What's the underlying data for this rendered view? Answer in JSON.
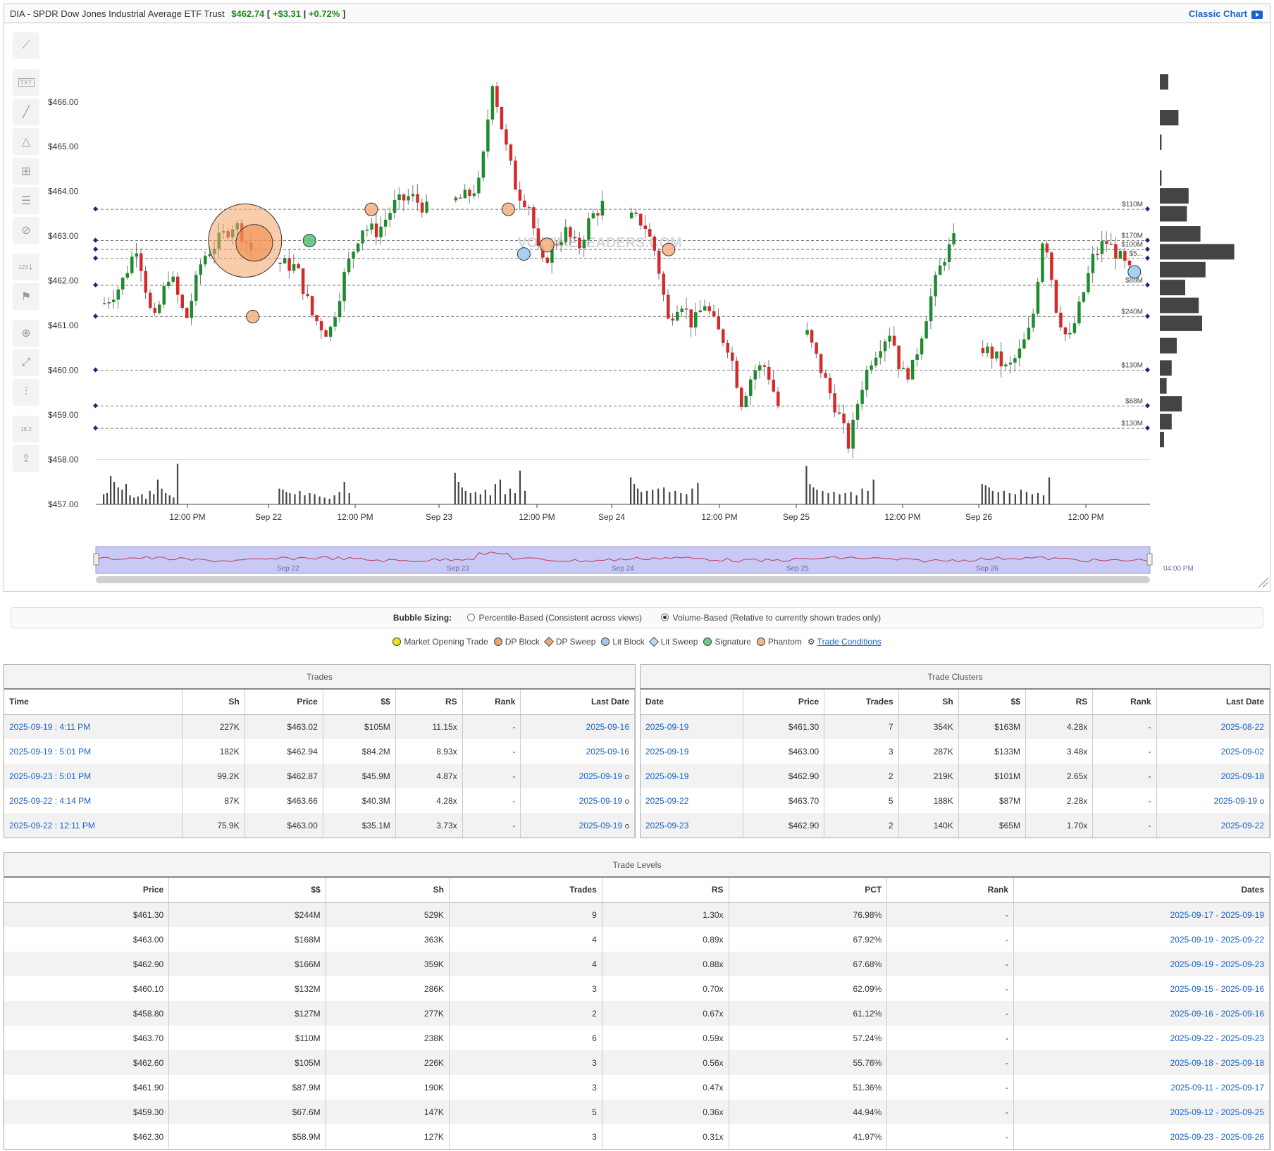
{
  "header": {
    "symbol": "DIA - SPDR Dow Jones Industrial Average ETF Trust",
    "price": "$462.74",
    "change": "+$3.31",
    "pct": "+0.72%",
    "open_bracket": "[",
    "sep": "|",
    "close_bracket": "]",
    "classic_chart": "Classic Chart"
  },
  "watermark": "VOLUMELEADERS.COM",
  "toolbar": {
    "txt": "TXT",
    "num": "123",
    "eye_label": "16.2"
  },
  "bubble_sizing": {
    "label": "Bubble Sizing:",
    "opt1": "Percentile-Based (Consistent across views)",
    "opt2": "Volume-Based (Relative to currently shown trades only)"
  },
  "legend": {
    "items": [
      {
        "label": "Market Opening Trade",
        "color": "#f4e417",
        "shape": "circle"
      },
      {
        "label": "DP Block",
        "color": "#f0a569",
        "shape": "circle"
      },
      {
        "label": "DP Sweep",
        "color": "#e8a878",
        "shape": "diamond"
      },
      {
        "label": "Lit Block",
        "color": "#9dcbf0",
        "shape": "circle"
      },
      {
        "label": "Lit Sweep",
        "color": "#b8d8f4",
        "shape": "diamond"
      },
      {
        "label": "Signature",
        "color": "#6cc98a",
        "shape": "circle"
      },
      {
        "label": "Phantom",
        "color": "#f3b68c",
        "shape": "circle"
      }
    ],
    "trade_conditions": "Trade Conditions"
  },
  "chart_data": {
    "type": "candlestick",
    "y_ticks": [
      "$466.00",
      "$465.00",
      "$464.00",
      "$463.00",
      "$462.00",
      "$461.00",
      "$460.00",
      "$459.00",
      "$458.00",
      "$457.00"
    ],
    "ylim": [
      457,
      466.8
    ],
    "x_labels": [
      "12:00 PM",
      "Sep 22",
      "12:00 PM",
      "Sep 23",
      "12:00 PM",
      "Sep 24",
      "12:00 PM",
      "Sep 25",
      "12:00 PM",
      "Sep 26",
      "12:00 PM"
    ],
    "nav_labels": [
      "Sep 22",
      "Sep 23",
      "Sep 24",
      "Sep 25",
      "Sep 26",
      "04:00 PM"
    ],
    "levels": [
      {
        "price": 463.6,
        "label": "$110M"
      },
      {
        "price": 462.9,
        "label": "$170M"
      },
      {
        "price": 462.7,
        "label": "$100M"
      },
      {
        "price": 462.5,
        "label": "$5..."
      },
      {
        "price": 461.9,
        "label": "$88M"
      },
      {
        "price": 461.2,
        "label": "$240M"
      },
      {
        "price": 460.0,
        "label": "$130M"
      },
      {
        "price": 459.2,
        "label": "$68M"
      },
      {
        "price": 458.7,
        "label": "$130M"
      }
    ],
    "days": [
      {
        "start": 461.5,
        "path": [
          461.9,
          462.8,
          461.0,
          462.2,
          461.1,
          462.5,
          462.9,
          463.3,
          462.7
        ],
        "vol": [
          9,
          10,
          25,
          20,
          15,
          13,
          18,
          8,
          6,
          7,
          9,
          5,
          12,
          9,
          22,
          14,
          10,
          8,
          6,
          36
        ]
      },
      {
        "start": 462.4,
        "path": [
          462.3,
          461.2,
          460.8,
          462.2,
          463.2,
          463.1,
          463.7,
          463.9,
          463.6
        ],
        "vol": [
          14,
          13,
          11,
          10,
          9,
          12,
          8,
          10,
          9,
          7,
          6,
          5,
          8,
          11,
          20,
          10
        ]
      },
      {
        "start": 463.8,
        "path": [
          463.9,
          464.2,
          466.5,
          465.1,
          464.0,
          463.7,
          462.3,
          462.8,
          463.1,
          462.7,
          463.4,
          463.7
        ],
        "vol": [
          28,
          20,
          15,
          12,
          10,
          11,
          9,
          13,
          8,
          18,
          22,
          9,
          14,
          10,
          30,
          12
        ]
      },
      {
        "start": 463.4,
        "path": [
          463.3,
          462.6,
          461.1,
          461.6,
          461.0,
          461.5,
          460.9,
          460.5,
          459.3,
          460.0,
          460.1,
          459.2
        ],
        "vol": [
          24,
          18,
          14,
          11,
          12,
          13,
          14,
          15,
          11,
          12,
          10,
          9,
          14,
          19
        ]
      },
      {
        "start": 460.8,
        "path": [
          460.2,
          459.6,
          459.0,
          458.3,
          459.5,
          460.2,
          460.6,
          460.9,
          459.9,
          460.0,
          460.9,
          461.8,
          462.5,
          462.9
        ],
        "vol": [
          34,
          18,
          15,
          13,
          12,
          10,
          11,
          9,
          10,
          11,
          8,
          14,
          12,
          22
        ]
      },
      {
        "start": 460.5,
        "path": [
          460.3,
          460.0,
          460.4,
          461.0,
          463.2,
          461.4,
          460.6,
          461.5,
          462.5,
          462.9,
          462.6,
          462.2
        ],
        "vol": [
          18,
          17,
          15,
          12,
          11,
          12,
          10,
          9,
          13,
          11,
          9,
          10,
          8,
          24
        ]
      }
    ],
    "bubbles": [
      {
        "day": 0,
        "f": 0.92,
        "price": 462.9,
        "r": 52,
        "color": "#f4a468",
        "alpha": 0.55
      },
      {
        "day": 0,
        "f": 0.98,
        "price": 462.85,
        "r": 26,
        "color": "#f08a4a",
        "alpha": 0.6
      },
      {
        "day": 0,
        "f": 0.97,
        "price": 461.2,
        "r": 9,
        "color": "#f4b486",
        "alpha": 0.9
      },
      {
        "day": 1,
        "f": 0.2,
        "price": 462.9,
        "r": 9,
        "color": "#5cc47e",
        "alpha": 0.9
      },
      {
        "day": 1,
        "f": 0.6,
        "price": 463.6,
        "r": 9,
        "color": "#f4b486",
        "alpha": 0.9
      },
      {
        "day": 2,
        "f": 0.35,
        "price": 463.6,
        "r": 9,
        "color": "#f4b486",
        "alpha": 0.9
      },
      {
        "day": 2,
        "f": 0.45,
        "price": 462.6,
        "r": 9,
        "color": "#9dcbf0",
        "alpha": 0.9
      },
      {
        "day": 2,
        "f": 0.6,
        "price": 462.8,
        "r": 10,
        "color": "#f4b486",
        "alpha": 0.9
      },
      {
        "day": 3,
        "f": 0.25,
        "price": 462.7,
        "r": 9,
        "color": "#f4b486",
        "alpha": 0.9
      },
      {
        "day": 5,
        "f": 0.99,
        "price": 462.2,
        "r": 9,
        "color": "#9dcbf0",
        "alpha": 0.9
      }
    ],
    "profile": [
      {
        "price": 466.45,
        "w": 10
      },
      {
        "price": 465.65,
        "w": 22
      },
      {
        "price": 465.1,
        "w": 2
      },
      {
        "price": 464.3,
        "w": 2
      },
      {
        "price": 463.9,
        "w": 34
      },
      {
        "price": 463.5,
        "w": 32
      },
      {
        "price": 463.05,
        "w": 48
      },
      {
        "price": 462.65,
        "w": 88
      },
      {
        "price": 462.25,
        "w": 54
      },
      {
        "price": 461.85,
        "w": 30
      },
      {
        "price": 461.45,
        "w": 46
      },
      {
        "price": 461.05,
        "w": 50
      },
      {
        "price": 460.55,
        "w": 20
      },
      {
        "price": 460.05,
        "w": 14
      },
      {
        "price": 459.65,
        "w": 8
      },
      {
        "price": 459.25,
        "w": 26
      },
      {
        "price": 458.85,
        "w": 14
      },
      {
        "price": 458.45,
        "w": 5
      }
    ]
  },
  "trades": {
    "title": "Trades",
    "columns": [
      "Time",
      "Sh",
      "Price",
      "$$",
      "RS",
      "Rank",
      "Last Date"
    ],
    "rows": [
      [
        "2025-09-19 : 4:11 PM",
        "227K",
        "$463.02",
        "$105M",
        "11.15x",
        "-",
        "2025-09-16",
        ""
      ],
      [
        "2025-09-19 : 5:01 PM",
        "182K",
        "$462.94",
        "$84.2M",
        "8.93x",
        "-",
        "2025-09-16",
        ""
      ],
      [
        "2025-09-23 : 5:01 PM",
        "99.2K",
        "$462.87",
        "$45.9M",
        "4.87x",
        "-",
        "2025-09-19",
        "o"
      ],
      [
        "2025-09-22 : 4:14 PM",
        "87K",
        "$463.66",
        "$40.3M",
        "4.28x",
        "-",
        "2025-09-19",
        "o"
      ],
      [
        "2025-09-22 : 12:11 PM",
        "75.9K",
        "$463.00",
        "$35.1M",
        "3.73x",
        "-",
        "2025-09-19",
        "o"
      ]
    ]
  },
  "clusters": {
    "title": "Trade Clusters",
    "columns": [
      "Date",
      "Price",
      "Trades",
      "Sh",
      "$$",
      "RS",
      "Rank",
      "Last Date"
    ],
    "rows": [
      [
        "2025-09-19",
        "$461.30",
        "7",
        "354K",
        "$163M",
        "4.28x",
        "-",
        "2025-08-22",
        ""
      ],
      [
        "2025-09-19",
        "$463.00",
        "3",
        "287K",
        "$133M",
        "3.48x",
        "-",
        "2025-09-02",
        ""
      ],
      [
        "2025-09-19",
        "$462.90",
        "2",
        "219K",
        "$101M",
        "2.65x",
        "-",
        "2025-09-18",
        ""
      ],
      [
        "2025-09-22",
        "$463.70",
        "5",
        "188K",
        "$87M",
        "2.28x",
        "-",
        "2025-09-19",
        "o"
      ],
      [
        "2025-09-23",
        "$462.90",
        "2",
        "140K",
        "$65M",
        "1.70x",
        "-",
        "2025-09-22",
        ""
      ]
    ]
  },
  "levels": {
    "title": "Trade Levels",
    "columns": [
      "Price",
      "$$",
      "Sh",
      "Trades",
      "RS",
      "PCT",
      "Rank",
      "Dates"
    ],
    "rows": [
      [
        "$461.30",
        "$244M",
        "529K",
        "9",
        "1.30x",
        "76.98%",
        "-",
        "2025-09-17 - 2025-09-19"
      ],
      [
        "$463.00",
        "$168M",
        "363K",
        "4",
        "0.89x",
        "67.92%",
        "-",
        "2025-09-19 - 2025-09-22"
      ],
      [
        "$462.90",
        "$166M",
        "359K",
        "4",
        "0.88x",
        "67.68%",
        "-",
        "2025-09-19 - 2025-09-23"
      ],
      [
        "$460.10",
        "$132M",
        "286K",
        "3",
        "0.70x",
        "62.09%",
        "-",
        "2025-09-15 - 2025-09-16"
      ],
      [
        "$458.80",
        "$127M",
        "277K",
        "2",
        "0.67x",
        "61.12%",
        "-",
        "2025-09-16 - 2025-09-16"
      ],
      [
        "$463.70",
        "$110M",
        "238K",
        "6",
        "0.59x",
        "57.24%",
        "-",
        "2025-09-22 - 2025-09-23"
      ],
      [
        "$462.60",
        "$105M",
        "226K",
        "3",
        "0.56x",
        "55.76%",
        "-",
        "2025-09-18 - 2025-09-18"
      ],
      [
        "$461.90",
        "$87.9M",
        "190K",
        "3",
        "0.47x",
        "51.36%",
        "-",
        "2025-09-11 - 2025-09-17"
      ],
      [
        "$459.30",
        "$67.6M",
        "147K",
        "5",
        "0.36x",
        "44.94%",
        "-",
        "2025-09-12 - 2025-09-25"
      ],
      [
        "$462.30",
        "$58.9M",
        "127K",
        "3",
        "0.31x",
        "41.97%",
        "-",
        "2025-09-23 - 2025-09-26"
      ]
    ]
  }
}
